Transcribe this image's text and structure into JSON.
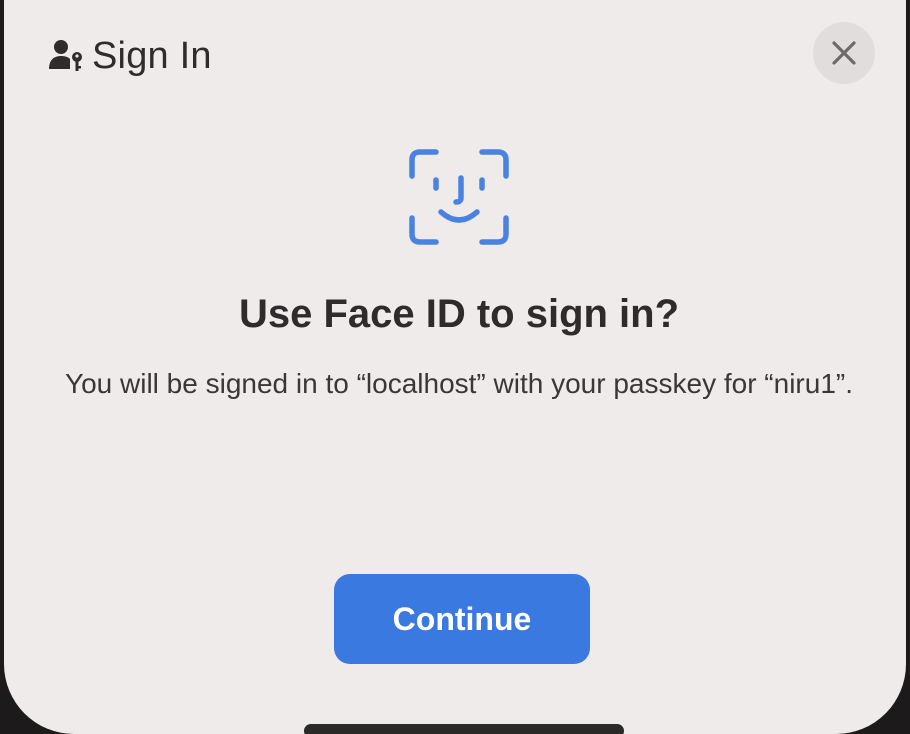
{
  "header": {
    "icon": "person-key-icon",
    "title": "Sign In"
  },
  "close": {
    "icon": "close-icon"
  },
  "face_id": {
    "icon": "face-id-icon",
    "color": "#4a82e0"
  },
  "dialog": {
    "title": "Use Face ID to sign in?",
    "message": "You will be signed in to “localhost” with your passkey for “niru1”."
  },
  "continue_button": {
    "label": "Continue",
    "color": "#3a79df"
  },
  "colors": {
    "background": "#f0ebeb",
    "close_bg": "#e2dddd",
    "text": "#2e2b2c"
  }
}
